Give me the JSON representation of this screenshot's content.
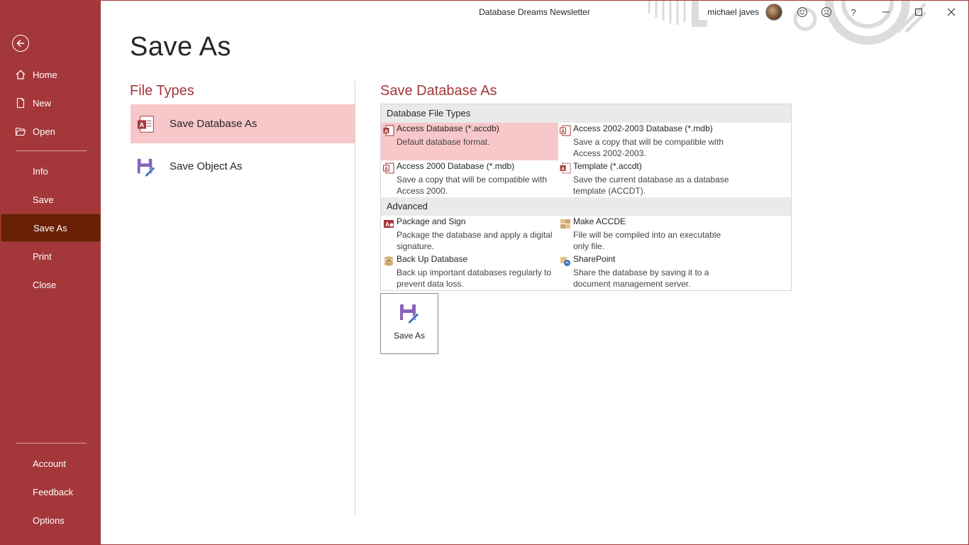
{
  "window": {
    "title": "Database Dreams Newsletter",
    "user_name": "michael javes"
  },
  "nav": {
    "top_items": [
      {
        "label": "Home",
        "icon": "home-icon"
      },
      {
        "label": "New",
        "icon": "new-document-icon"
      },
      {
        "label": "Open",
        "icon": "open-folder-icon"
      }
    ],
    "mid_items": [
      "Info",
      "Save",
      "Save As",
      "Print",
      "Close"
    ],
    "active": "Save As",
    "bottom_items": [
      "Account",
      "Feedback",
      "Options"
    ]
  },
  "main": {
    "title": "Save As",
    "file_types_title": "File Types",
    "file_types": [
      "Save Database As",
      "Save Object As"
    ],
    "selected_file_type": "Save Database As",
    "panel_title": "Save Database As",
    "groups": {
      "database_file_types": {
        "header": "Database File Types",
        "options": [
          {
            "title": "Access Database (*.accdb)",
            "desc": "Default database format."
          },
          {
            "title": "Access 2002-2003 Database (*.mdb)",
            "desc": "Save a copy that will be compatible with Access 2002-2003."
          },
          {
            "title": "Access 2000 Database (*.mdb)",
            "desc": "Save a copy that will be compatible with Access 2000."
          },
          {
            "title": "Template (*.accdt)",
            "desc": "Save the current database as a database template (ACCDT)."
          }
        ]
      },
      "advanced": {
        "header": "Advanced",
        "options": [
          {
            "title": "Package and Sign",
            "desc": "Package the database and apply a digital signature."
          },
          {
            "title": "Make ACCDE",
            "desc": "File will be compiled into an executable only file."
          },
          {
            "title": "Back Up Database",
            "desc": "Back up important databases regularly to prevent data loss."
          },
          {
            "title": "SharePoint",
            "desc": "Share the database by saving it to a document management server."
          }
        ]
      }
    },
    "selected_option": "Access Database (*.accdb)",
    "save_button_label": "Save As"
  },
  "colors": {
    "accent": "#a4373a",
    "active_nav": "#6a2005",
    "selection": "#f8c7ca"
  }
}
